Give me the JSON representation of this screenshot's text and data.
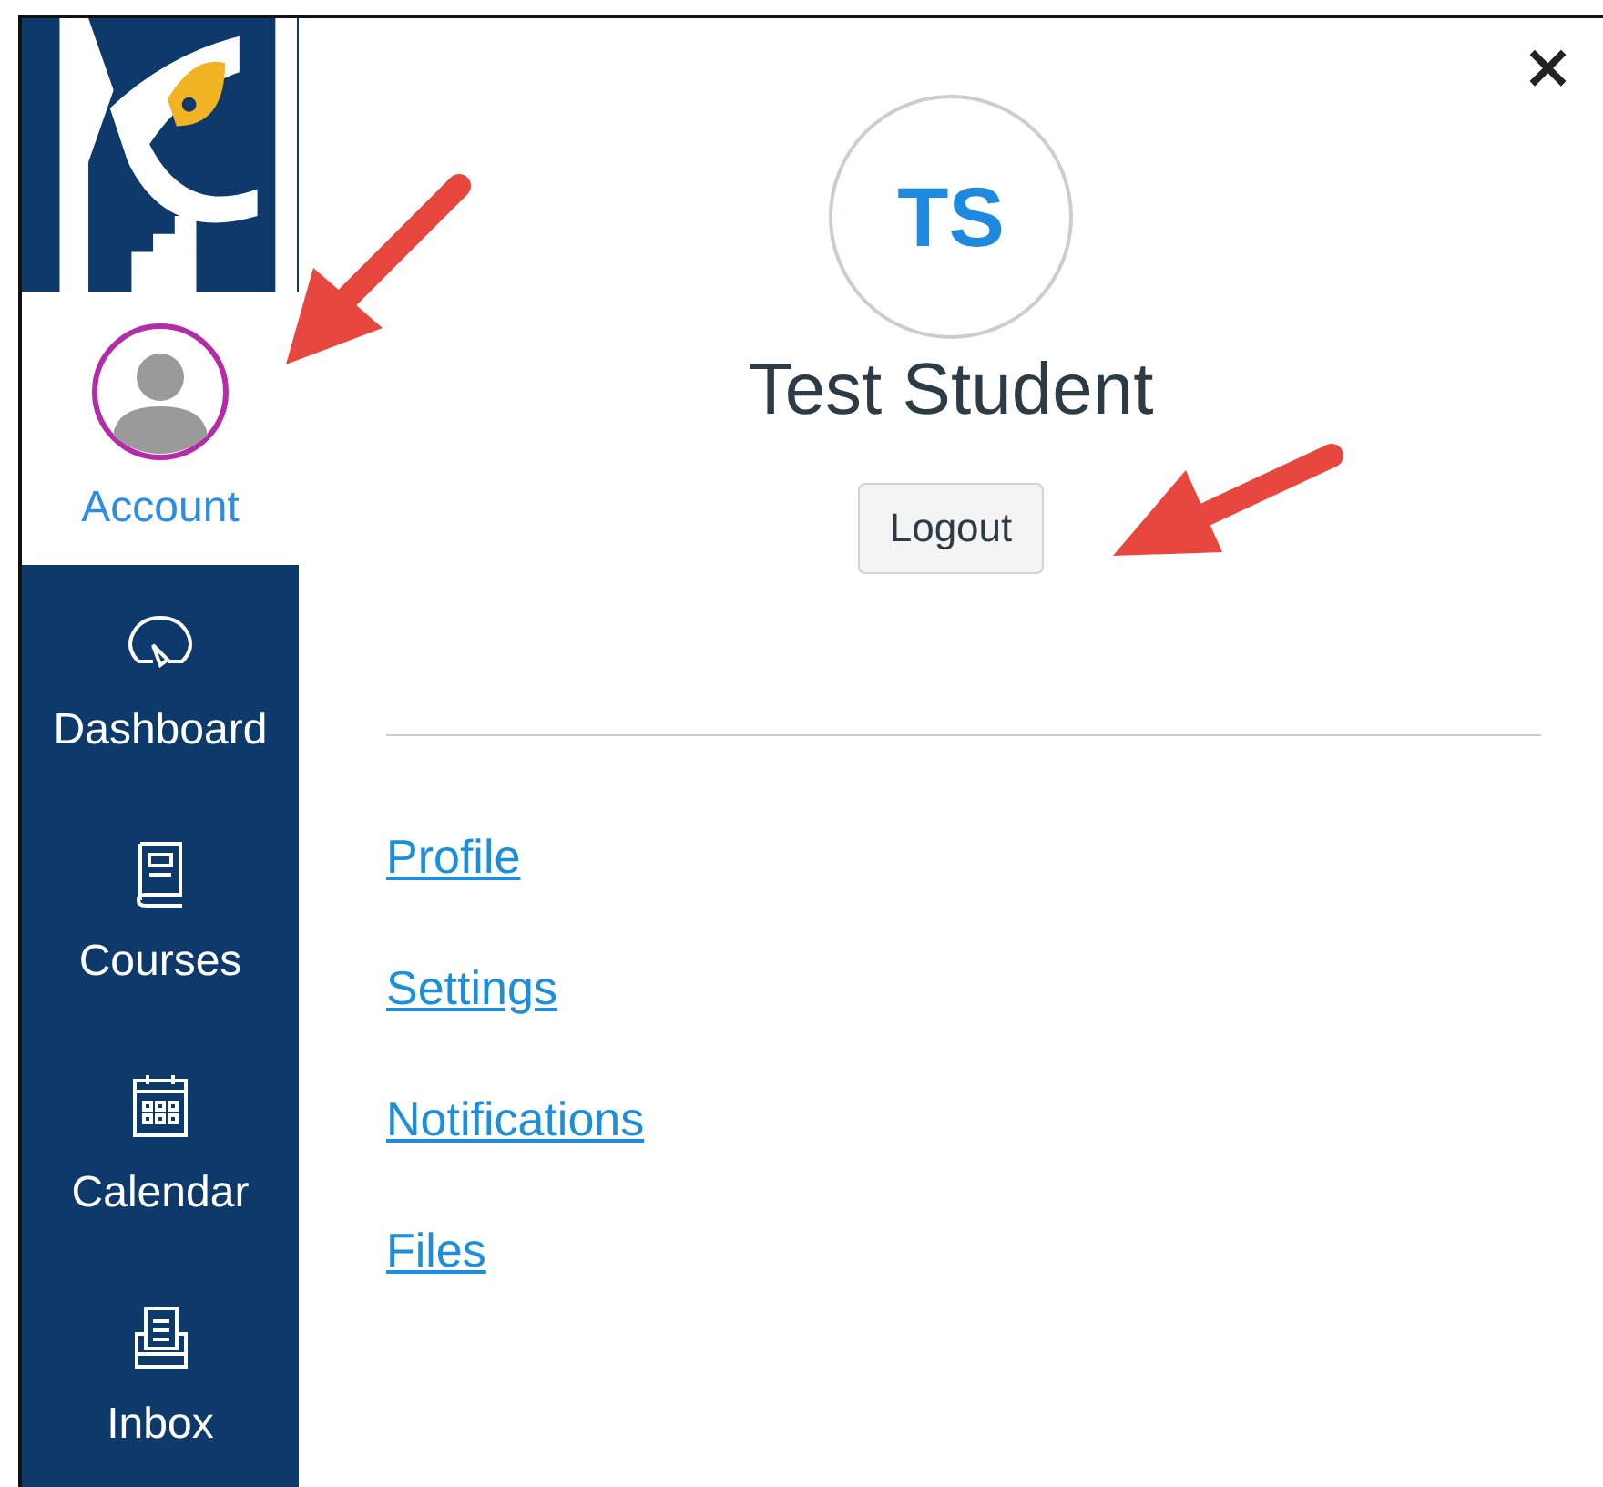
{
  "nav": [
    {
      "kind": "avatar",
      "label": "Account",
      "selected": true
    },
    {
      "kind": "gauge",
      "label": "Dashboard",
      "selected": false
    },
    {
      "kind": "book",
      "label": "Courses",
      "selected": false
    },
    {
      "kind": "calendar",
      "label": "Calendar",
      "selected": false
    },
    {
      "kind": "tray",
      "label": "Inbox",
      "selected": false
    }
  ],
  "close": "×",
  "profile": {
    "initials": "TS",
    "name": "Test Student",
    "logout": "Logout"
  },
  "links": [
    "Profile",
    "Settings",
    "Notifications",
    "Files"
  ]
}
